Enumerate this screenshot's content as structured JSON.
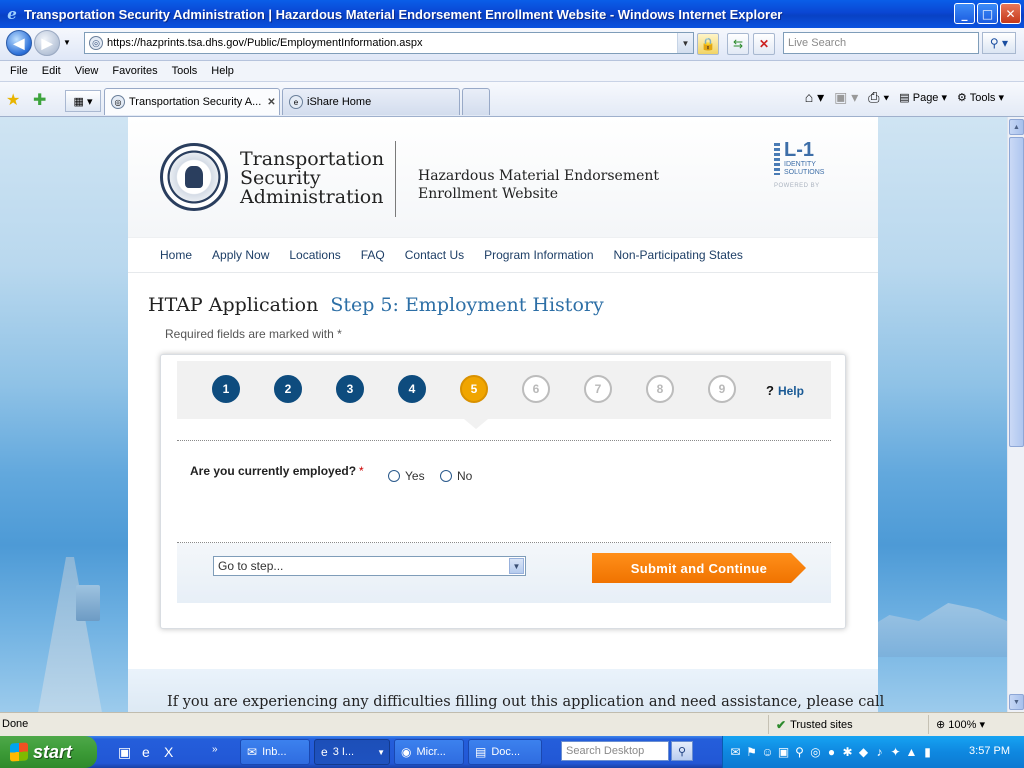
{
  "window": {
    "title": "Transportation Security Administration | Hazardous Material Endorsement Enrollment Website - Windows Internet Explorer",
    "min": "_",
    "max": "□",
    "close": "✕"
  },
  "address_bar": {
    "url": "https://hazprints.tsa.dhs.gov/Public/EmploymentInformation.aspx",
    "search_placeholder": "Live Search"
  },
  "menu": [
    "File",
    "Edit",
    "View",
    "Favorites",
    "Tools",
    "Help"
  ],
  "tabs": [
    {
      "label": "Transportation Security A...",
      "close": "✕"
    },
    {
      "label": "iShare Home"
    }
  ],
  "command_bar": {
    "page": "Page",
    "tools": "Tools"
  },
  "page": {
    "agency_name": "Transportation Security Administration",
    "site_title": "Hazardous Material Endorsement Enrollment Website",
    "partner_logo": {
      "mark": "L-1",
      "line": "IDENTITY SOLUTIONS",
      "powered": "POWERED BY"
    },
    "nav": [
      "Home",
      "Apply Now",
      "Locations",
      "FAQ",
      "Contact Us",
      "Program Information",
      "Non-Participating States"
    ],
    "app_title": "HTAP Application",
    "step_title": "Step 5: Employment History",
    "required_note": "Required fields are marked with *",
    "steps": [
      {
        "num": "1",
        "state": "done"
      },
      {
        "num": "2",
        "state": "done"
      },
      {
        "num": "3",
        "state": "done"
      },
      {
        "num": "4",
        "state": "done"
      },
      {
        "num": "5",
        "state": "current"
      },
      {
        "num": "6",
        "state": "todo"
      },
      {
        "num": "7",
        "state": "todo"
      },
      {
        "num": "8",
        "state": "todo"
      },
      {
        "num": "9",
        "state": "todo"
      }
    ],
    "help_mark": "?",
    "help_label": "Help",
    "question": "Are you currently employed?",
    "required_mark": "*",
    "options": [
      "Yes",
      "No"
    ],
    "goto_step": "Go to step...",
    "submit_label": "Submit and Continue",
    "footer_text": "If you are experiencing any difficulties filling out this application and need assistance, please call"
  },
  "status_bar": {
    "status": "Done",
    "zone": "Trusted sites",
    "zoom": "100%"
  },
  "taskbar": {
    "start": "start",
    "tasks": [
      "Inb...",
      "3 I...",
      "Micr...",
      "Doc..."
    ],
    "search_placeholder": "Search Desktop",
    "clock": "3:57 PM"
  },
  "colors": {
    "accent_blue": "#0e4c7e",
    "current_step": "#f0a500",
    "submit": "#f07300",
    "step_title": "#2d6fa6"
  }
}
